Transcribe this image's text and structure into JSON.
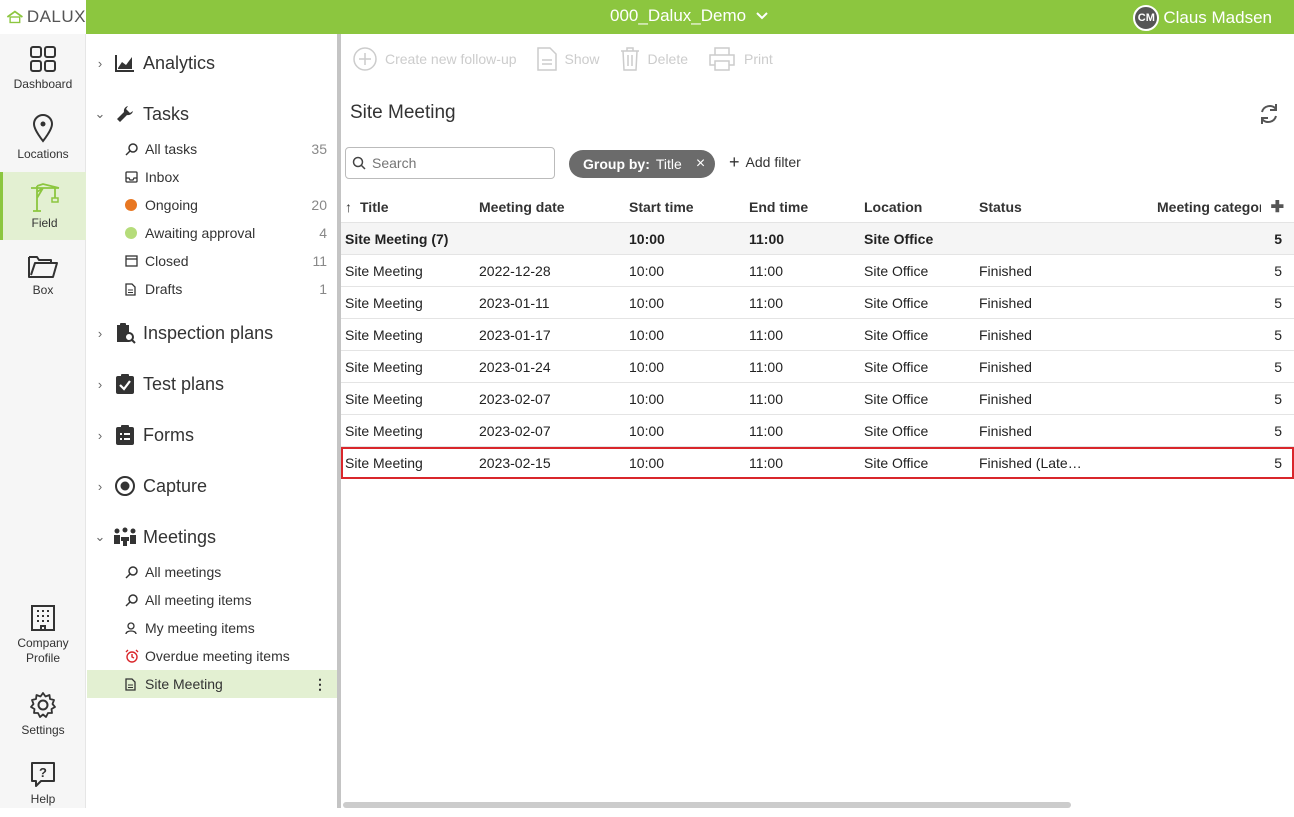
{
  "app": {
    "logo_text": "DALUX",
    "brand_color": "#8cc63f"
  },
  "header": {
    "project": "000_Dalux_Demo",
    "user_initials": "CM",
    "user_name": "Claus Madsen"
  },
  "rail": {
    "dashboard": "Dashboard",
    "locations": "Locations",
    "field": "Field",
    "box": "Box",
    "company": "Company Profile",
    "settings": "Settings",
    "help": "Help"
  },
  "nav": {
    "analytics": "Analytics",
    "tasks": "Tasks",
    "tasks_items": [
      {
        "label": "All tasks",
        "count": "35"
      },
      {
        "label": "Inbox",
        "count": ""
      },
      {
        "label": "Ongoing",
        "count": "20"
      },
      {
        "label": "Awaiting approval",
        "count": "4"
      },
      {
        "label": "Closed",
        "count": "11"
      },
      {
        "label": "Drafts",
        "count": "1"
      }
    ],
    "inspection": "Inspection plans",
    "test": "Test plans",
    "forms": "Forms",
    "capture": "Capture",
    "meetings": "Meetings",
    "meetings_items": [
      {
        "label": "All meetings"
      },
      {
        "label": "All meeting items"
      },
      {
        "label": "My meeting items"
      },
      {
        "label": "Overdue meeting items"
      },
      {
        "label": "Site Meeting"
      }
    ]
  },
  "toolbar": {
    "create": "Create new follow-up",
    "show": "Show",
    "delete": "Delete",
    "print": "Print"
  },
  "main": {
    "title": "Site Meeting",
    "search_placeholder": "Search",
    "chip_label": "Group by:",
    "chip_value": "Title",
    "add_filter": "Add filter"
  },
  "table": {
    "columns": [
      "Title",
      "Meeting date",
      "Start time",
      "End time",
      "Location",
      "Status",
      "Meeting categori"
    ],
    "group": {
      "title": "Site Meeting (7)",
      "start": "10:00",
      "end": "11:00",
      "location": "Site Office",
      "cat": "5"
    },
    "rows": [
      {
        "title": "Site Meeting",
        "date": "2022-12-28",
        "start": "10:00",
        "end": "11:00",
        "location": "Site Office",
        "status": "Finished",
        "cat": "5"
      },
      {
        "title": "Site Meeting",
        "date": "2023-01-11",
        "start": "10:00",
        "end": "11:00",
        "location": "Site Office",
        "status": "Finished",
        "cat": "5"
      },
      {
        "title": "Site Meeting",
        "date": "2023-01-17",
        "start": "10:00",
        "end": "11:00",
        "location": "Site Office",
        "status": "Finished",
        "cat": "5"
      },
      {
        "title": "Site Meeting",
        "date": "2023-01-24",
        "start": "10:00",
        "end": "11:00",
        "location": "Site Office",
        "status": "Finished",
        "cat": "5"
      },
      {
        "title": "Site Meeting",
        "date": "2023-02-07",
        "start": "10:00",
        "end": "11:00",
        "location": "Site Office",
        "status": "Finished",
        "cat": "5"
      },
      {
        "title": "Site Meeting",
        "date": "2023-02-07",
        "start": "10:00",
        "end": "11:00",
        "location": "Site Office",
        "status": "Finished",
        "cat": "5"
      },
      {
        "title": "Site Meeting",
        "date": "2023-02-15",
        "start": "10:00",
        "end": "11:00",
        "location": "Site Office",
        "status": "Finished (Late…",
        "cat": "5"
      }
    ]
  }
}
